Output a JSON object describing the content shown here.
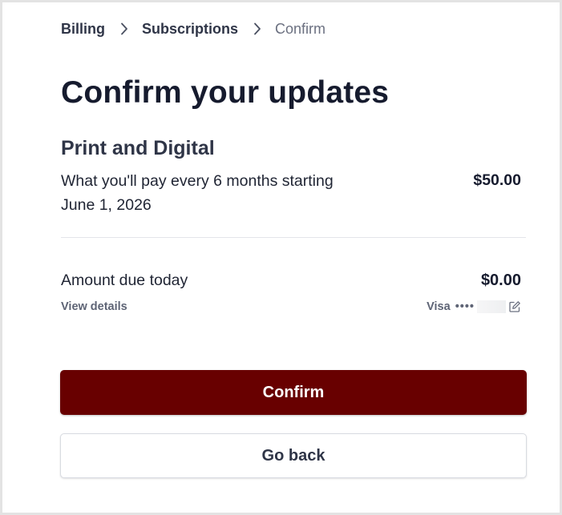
{
  "breadcrumb": {
    "items": [
      "Billing",
      "Subscriptions",
      "Confirm"
    ]
  },
  "title": "Confirm your updates",
  "plan": {
    "name": "Print and Digital",
    "description": "What you'll pay every 6 months starting June 1, 2026",
    "price": "$50.00"
  },
  "due": {
    "label": "Amount due today",
    "amount": "$0.00",
    "details_link": "View details"
  },
  "payment": {
    "brand": "Visa",
    "masked": "••••"
  },
  "actions": {
    "confirm_label": "Confirm",
    "back_label": "Go back"
  },
  "colors": {
    "confirm_bg": "#680000",
    "title": "#161b2e"
  },
  "icons": {
    "separator": "chevron-right-icon",
    "edit": "edit-icon"
  }
}
